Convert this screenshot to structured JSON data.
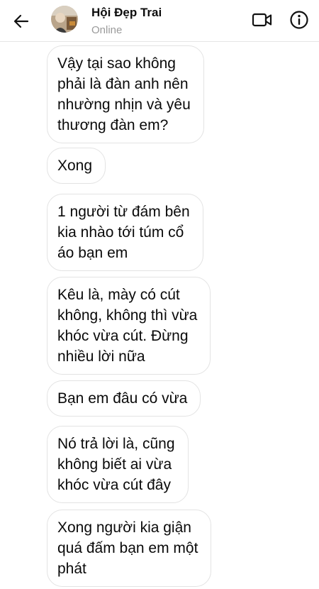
{
  "header": {
    "title": "Hội Đẹp Trai",
    "status": "Online",
    "back_icon": "back-arrow-icon",
    "video_icon": "video-call-icon",
    "info_icon": "info-icon"
  },
  "messages": [
    {
      "text": "Vậy tại sao không\nphải là đàn anh nên\nnhường nhịn và yêu\nthương đàn em?"
    },
    {
      "text": "Xong"
    },
    {
      "text": "1 người từ đám bên\nkia nhào tới túm cổ\náo bạn em"
    },
    {
      "text": "Kêu là, mày có cút\nkhông, không thì vừa\nkhóc vừa cút. Đừng\nnhiều lời nữa"
    },
    {
      "text": "Bạn em đâu có vừa"
    },
    {
      "text": "Nó trả lời là, cũng\nkhông biết ai vừa\nkhóc vừa cút đây"
    },
    {
      "text": "Xong người kia giận\nquá đấm bạn em một\nphát"
    }
  ],
  "colors": {
    "bubble_border": "#e3e3e3",
    "status_text": "#9a9a9a",
    "icon": "#111111"
  }
}
